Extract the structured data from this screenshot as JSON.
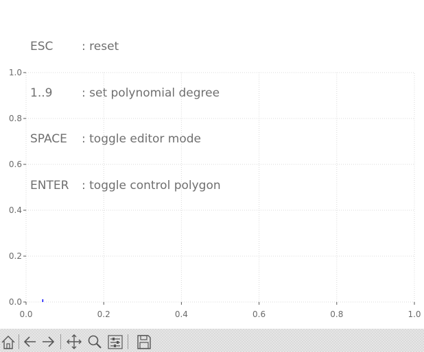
{
  "help": {
    "lines": [
      {
        "key": "ESC",
        "desc": ": reset"
      },
      {
        "key": "1..9",
        "desc": ": set polynomial degree"
      },
      {
        "key": "SPACE",
        "desc": ": toggle editor mode"
      },
      {
        "key": "ENTER",
        "desc": ": toggle control polygon"
      }
    ]
  },
  "chart_data": {
    "type": "scatter",
    "title": "",
    "xlabel": "",
    "ylabel": "",
    "xlim": [
      0.0,
      1.0
    ],
    "ylim": [
      0.0,
      1.0
    ],
    "xticks": [
      "0.0",
      "0.2",
      "0.4",
      "0.6",
      "0.8",
      "1.0"
    ],
    "yticks": [
      "0.0",
      "0.2",
      "0.4",
      "0.6",
      "0.8",
      "1.0"
    ],
    "grid": true,
    "series": [
      {
        "x": [
          0.043
        ],
        "y": [
          0.0
        ],
        "color": "#0000ff"
      }
    ]
  },
  "toolbar": {
    "buttons": [
      {
        "name": "home-button",
        "icon": "home-icon"
      },
      {
        "name": "back-button",
        "icon": "back-arrow-icon"
      },
      {
        "name": "forward-button",
        "icon": "forward-arrow-icon"
      },
      {
        "name": "pan-button",
        "icon": "move-icon"
      },
      {
        "name": "zoom-button",
        "icon": "zoom-icon"
      },
      {
        "name": "configure-subplots-button",
        "icon": "sliders-icon"
      },
      {
        "name": "save-button",
        "icon": "floppy-disk-icon"
      }
    ]
  },
  "colors": {
    "axis": "#555555",
    "tick_label": "#6a6a6a",
    "grid": "#d8d8d8",
    "point": "#0000ff"
  }
}
